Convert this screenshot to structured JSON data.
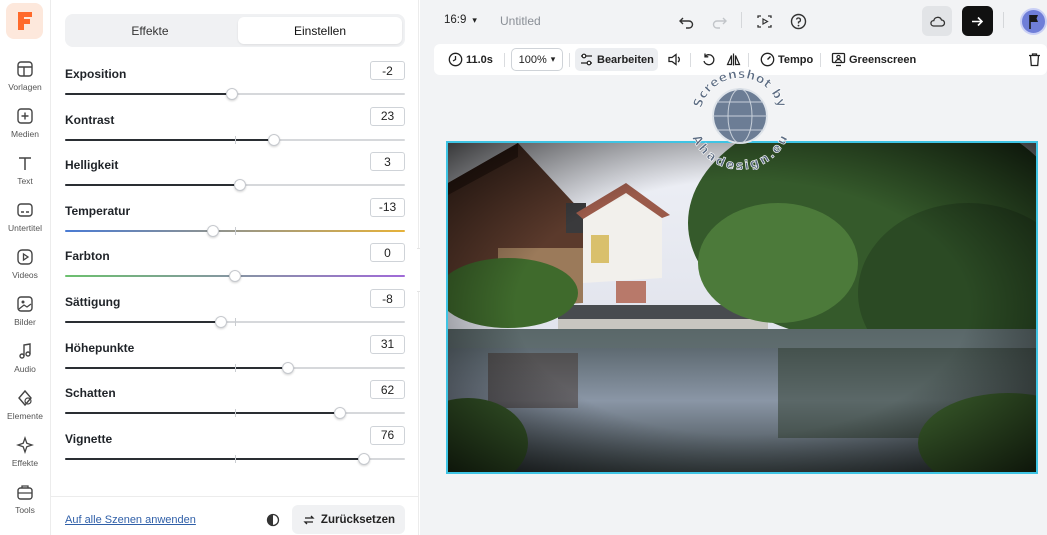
{
  "rail": {
    "items": [
      {
        "label": "Vorlagen",
        "icon": "layout-icon"
      },
      {
        "label": "Medien",
        "icon": "media-plus-icon"
      },
      {
        "label": "Text",
        "icon": "text-icon"
      },
      {
        "label": "Untertitel",
        "icon": "subtitles-icon"
      },
      {
        "label": "Videos",
        "icon": "play-circle-icon"
      },
      {
        "label": "Bilder",
        "icon": "image-icon"
      },
      {
        "label": "Audio",
        "icon": "music-note-icon"
      },
      {
        "label": "Elemente",
        "icon": "shapes-icon"
      },
      {
        "label": "Effekte",
        "icon": "sparkle-icon"
      },
      {
        "label": "Tools",
        "icon": "toolbox-icon"
      }
    ]
  },
  "panel": {
    "tabs": [
      "Effekte",
      "Einstellen"
    ],
    "active_tab": "Einstellen",
    "adjustments": [
      {
        "label": "Exposition",
        "value": "-2",
        "level": 0.49
      },
      {
        "label": "Kontrast",
        "value": "23",
        "level": 0.615
      },
      {
        "label": "Helligkeit",
        "value": "3",
        "level": 0.515
      },
      {
        "label": "Temperatur",
        "value": "-13",
        "level": 0.435
      },
      {
        "label": "Farbton",
        "value": "0",
        "level": 0.5
      },
      {
        "label": "Sättigung",
        "value": "-8",
        "level": 0.46
      },
      {
        "label": "Höhepunkte",
        "value": "31",
        "level": 0.655
      },
      {
        "label": "Schatten",
        "value": "62",
        "level": 0.81
      },
      {
        "label": "Vignette",
        "value": "76",
        "level": 0.88
      }
    ],
    "apply_all_label": "Auf alle Szenen anwenden",
    "reset_label": "Zurücksetzen"
  },
  "header": {
    "aspect_ratio": "16:9",
    "project_title": "Untitled"
  },
  "toolbar": {
    "duration": "11.0s",
    "zoom": "100%",
    "edit_label": "Bearbeiten",
    "speed_label": "Tempo",
    "greenscreen_label": "Greenscreen"
  },
  "watermark": {
    "text_top": "Screenshot by",
    "text_bottom": "Ahadesign.eu"
  },
  "colors": {
    "accent": "#3fc4e4",
    "brand": "#ff6a2b",
    "export_bg": "#111111",
    "temperature_gradient": [
      "#4a7bd4",
      "#e6b23a"
    ],
    "hue_gradient": [
      "#6cc06e",
      "#a06ad8"
    ]
  }
}
